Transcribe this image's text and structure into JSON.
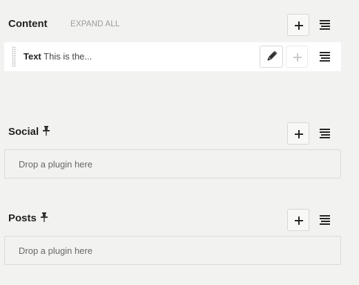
{
  "sections": {
    "content": {
      "title": "Content",
      "expand_all_label": "EXPAND ALL",
      "add_icon": "plus-icon",
      "menu_icon": "hamburger-menu-icon",
      "plugins": [
        {
          "type_label": "Text",
          "preview": "This is the...",
          "edit_icon": "pencil-icon",
          "add_icon": "plus-icon",
          "menu_icon": "hamburger-menu-icon"
        }
      ]
    },
    "social": {
      "title": "Social",
      "pinned_icon": "pin-icon",
      "add_icon": "plus-icon",
      "menu_icon": "hamburger-menu-icon",
      "dropzone_text": "Drop a plugin here"
    },
    "posts": {
      "title": "Posts",
      "pinned_icon": "pin-icon",
      "add_icon": "plus-icon",
      "menu_icon": "hamburger-menu-icon",
      "dropzone_text": "Drop a plugin here"
    }
  },
  "colors": {
    "background": "#f2f2f0",
    "plugin_background": "#ffffff",
    "border": "#d6d6d4",
    "muted_text": "#999999"
  }
}
